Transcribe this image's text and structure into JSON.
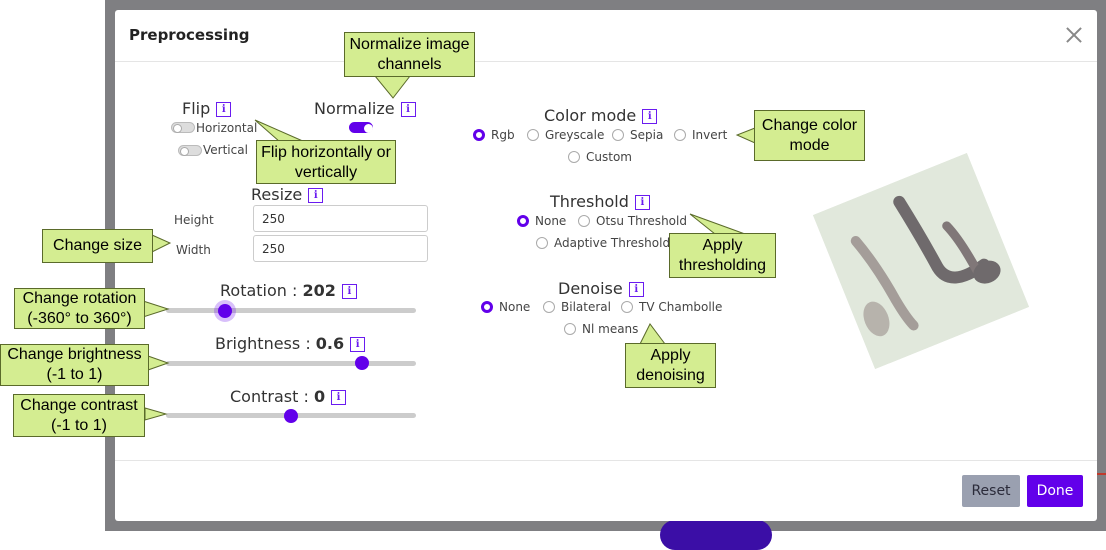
{
  "dialog": {
    "title": "Preprocessing"
  },
  "flip": {
    "title": "Flip",
    "horizontal_label": "Horizontal",
    "vertical_label": "Vertical",
    "horizontal_on": false,
    "vertical_on": false
  },
  "normalize": {
    "title": "Normalize",
    "on": true
  },
  "resize": {
    "title": "Resize",
    "height_label": "Height",
    "height_value": "250",
    "width_label": "Width",
    "width_value": "250"
  },
  "rotation": {
    "label": "Rotation : ",
    "value": "202",
    "min": -360,
    "max": 360
  },
  "brightness": {
    "label": "Brightness : ",
    "value": "0.6",
    "min": -1,
    "max": 1
  },
  "contrast": {
    "label": "Contrast : ",
    "value": "0",
    "min": -1,
    "max": 1
  },
  "color_mode": {
    "title": "Color mode",
    "options": [
      "Rgb",
      "Greyscale",
      "Sepia",
      "Invert",
      "Custom"
    ],
    "selected": "Rgb"
  },
  "threshold": {
    "title": "Threshold",
    "options": [
      "None",
      "Otsu Threshold",
      "Adaptive Threshold"
    ],
    "selected": "None"
  },
  "denoise": {
    "title": "Denoise",
    "options": [
      "None",
      "Bilateral",
      "TV Chambolle",
      "Nl means"
    ],
    "selected": "None"
  },
  "footer": {
    "reset_label": "Reset",
    "done_label": "Done"
  },
  "annotations": {
    "normalize": "Normalize image channels",
    "flip": "Flip horizontally or vertically",
    "color_mode": "Change color mode",
    "size": "Change size",
    "thresholding": "Apply thresholding",
    "rotation": "Change rotation (-360° to 360°)",
    "brightness": "Change brightness (-1 to 1)",
    "contrast": "Change contrast (-1 to 1)",
    "denoising": "Apply denoising"
  },
  "icons": {
    "info": "info-icon",
    "close": "close-icon"
  },
  "colors": {
    "accent": "#6200ea",
    "callout_fill": "#d4ed91",
    "reset_button": "#9aa0b0",
    "backdrop": "#7f7f82"
  }
}
